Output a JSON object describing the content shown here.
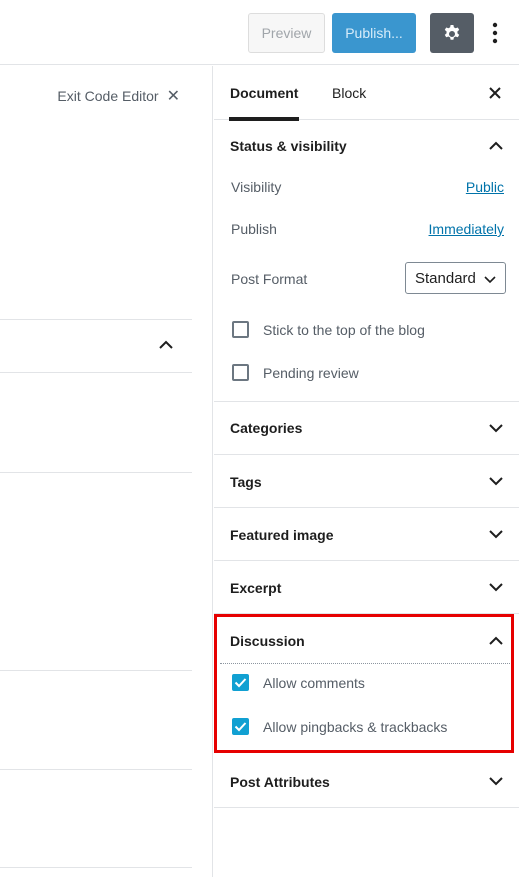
{
  "toolbar": {
    "preview_label": "Preview",
    "publish_label": "Publish...",
    "settings_icon": "gear-icon",
    "more_icon": "more-vertical-icon"
  },
  "editor": {
    "exit_code_editor_label": "Exit Code Editor"
  },
  "sidebar": {
    "tabs": [
      {
        "label": "Document",
        "active": true
      },
      {
        "label": "Block",
        "active": false
      }
    ],
    "status_visibility": {
      "title": "Status & visibility",
      "visibility_label": "Visibility",
      "visibility_value": "Public",
      "publish_label": "Publish",
      "publish_value": "Immediately",
      "post_format_label": "Post Format",
      "post_format_value": "Standard",
      "sticky_label": "Stick to the top of the blog",
      "sticky_checked": false,
      "pending_label": "Pending review",
      "pending_checked": false
    },
    "panels": [
      {
        "title": "Categories"
      },
      {
        "title": "Tags"
      },
      {
        "title": "Featured image"
      },
      {
        "title": "Excerpt"
      }
    ],
    "discussion": {
      "title": "Discussion",
      "allow_comments_label": "Allow comments",
      "allow_comments_checked": true,
      "allow_pingbacks_label": "Allow pingbacks & trackbacks",
      "allow_pingbacks_checked": true
    },
    "post_attributes": {
      "title": "Post Attributes"
    }
  },
  "colors": {
    "accent_blue": "#3a96cf",
    "link_blue": "#0073aa",
    "checkbox_blue": "#11a0d2",
    "highlight_red": "#e60000"
  }
}
